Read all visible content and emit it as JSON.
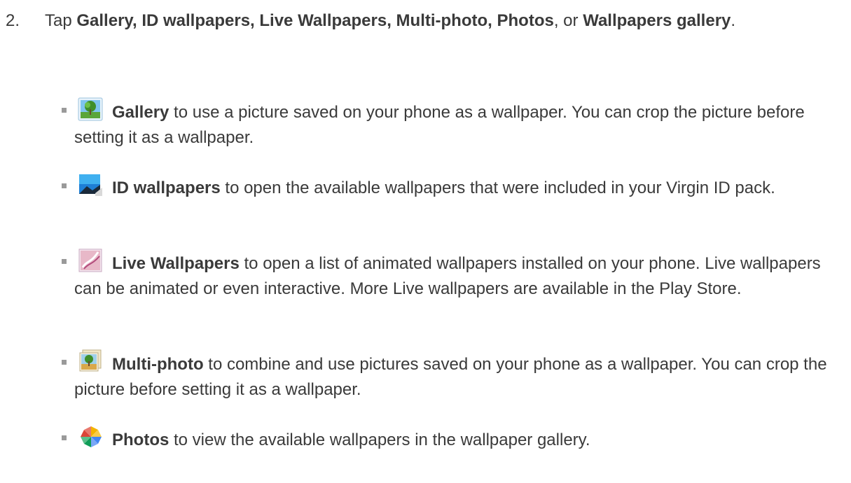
{
  "step": {
    "number": "2.",
    "tap": "Tap",
    "opt1": "Gallery, ID wallpapers, Live Wallpapers, Multi-photo, Photos",
    "or": ", or",
    "opt2": "Wallpapers gallery",
    "end": "."
  },
  "items": [
    {
      "icon": "gallery-icon",
      "title": "Gallery",
      "text": " to use a picture saved on your phone as a wallpaper. You can crop the picture before setting it as a wallpaper."
    },
    {
      "icon": "id-wallpapers-icon",
      "title": "ID wallpapers",
      "text": " to open the available wallpapers that were included in your Virgin ID pack."
    },
    {
      "icon": "live-wallpapers-icon",
      "title": "Live Wallpapers",
      "text": " to open a list of animated wallpapers installed on your phone. Live wallpapers can be animated or even interactive. More Live wallpapers are available in the Play Store."
    },
    {
      "icon": "multi-photo-icon",
      "title": "Multi-photo",
      "text": " to combine and use pictures saved on your phone as a wallpaper. You can crop the picture before setting it as a wallpaper."
    },
    {
      "icon": "photos-icon",
      "title": "Photos",
      "text": " to view the available wallpapers in the wallpaper gallery."
    }
  ]
}
